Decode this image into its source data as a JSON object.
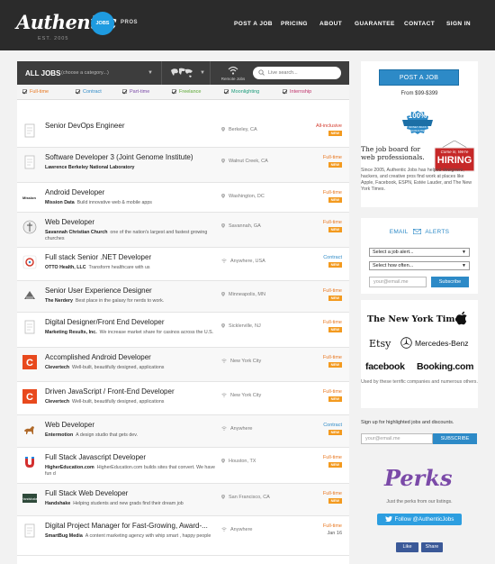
{
  "header": {
    "logo": "Authentic",
    "est": "EST. 2005",
    "badge": "JOBS",
    "pros": "PROS",
    "nav": [
      "POST A JOB",
      "PRICING",
      "ABOUT",
      "GUARANTEE",
      "CONTACT",
      "SIGN IN"
    ]
  },
  "filter": {
    "title": "ALL JOBS",
    "category_placeholder": "(choose a category...)",
    "remote_label": "Remote Jobs",
    "search_placeholder": "Live search..."
  },
  "types": [
    {
      "label": "Full-time",
      "color": "#e8761e"
    },
    {
      "label": "Contract",
      "color": "#2d8ac7"
    },
    {
      "label": "Part-time",
      "color": "#7b4aa8"
    },
    {
      "label": "Freelance",
      "color": "#5aa832"
    },
    {
      "label": "Moonlighting",
      "color": "#1a9b7a"
    },
    {
      "label": "Internship",
      "color": "#c0306a"
    }
  ],
  "jobs": [
    {
      "title": "Senior DevOps Engineer",
      "company": "",
      "desc": "",
      "location": "Berkeley, CA",
      "type": "All-inclusive",
      "type_color": "#d33a2c",
      "badge": "NEW",
      "date": "",
      "logo": "doc"
    },
    {
      "title": "Software Developer 3 (Joint Genome Institute)",
      "company": "Lawrence Berkeley National Laboratory",
      "desc": "",
      "location": "Walnut Creek, CA",
      "type": "Full-time",
      "type_color": "#e8761e",
      "badge": "NEW",
      "date": "",
      "logo": "doc"
    },
    {
      "title": "Android Developer",
      "company": "Mission Data",
      "desc": "Build innovative web & mobile apps",
      "location": "Washington, DC",
      "type": "Full-time",
      "type_color": "#e8761e",
      "badge": "NEW",
      "date": "",
      "logo": "mission"
    },
    {
      "title": "Web Developer",
      "company": "Savannah Christian Church",
      "desc": "one of the nation's largest and fastest growing churches",
      "location": "Savannah, GA",
      "type": "Full-time",
      "type_color": "#e8761e",
      "badge": "NEW",
      "date": "",
      "logo": "church"
    },
    {
      "title": "Full stack Senior .NET Developer",
      "company": "OTTO Health, LLC",
      "desc": "Transform healthcare with us",
      "location": "Anywhere, USA",
      "type": "Contract",
      "type_color": "#2d8ac7",
      "badge": "NEW",
      "date": "",
      "logo": "otto"
    },
    {
      "title": "Senior User Experience Designer",
      "company": "The Nerdery",
      "desc": "Best place in the galaxy for nerds to work.",
      "location": "Minneapolis, MN",
      "type": "Full-time",
      "type_color": "#e8761e",
      "badge": "NEW",
      "date": "",
      "logo": "nerdery"
    },
    {
      "title": "Digital Designer/Front End Developer",
      "company": "Marketing Results, Inc.",
      "desc": "We increase market share for casinos across the U.S.",
      "location": "Sicklerville, NJ",
      "type": "Full-time",
      "type_color": "#e8761e",
      "badge": "NEW",
      "date": "",
      "logo": "doc"
    },
    {
      "title": "Accomplished Android Developer",
      "company": "Clevertech",
      "desc": "Well-built, beautifully designed, applications",
      "location": "New York City",
      "type": "Full-time",
      "type_color": "#e8761e",
      "badge": "NEW",
      "date": "",
      "logo": "clever"
    },
    {
      "title": "Driven JavaScript / Front-End Developer",
      "company": "Clevertech",
      "desc": "Well-built, beautifully designed, applications",
      "location": "New York City",
      "type": "Full-time",
      "type_color": "#e8761e",
      "badge": "NEW",
      "date": "",
      "logo": "clever"
    },
    {
      "title": "Web Developer",
      "company": "Entermotion",
      "desc": "A design studio that gets dev.",
      "location": "Anywhere",
      "type": "Contract",
      "type_color": "#2d8ac7",
      "badge": "NEW",
      "date": "",
      "logo": "horse"
    },
    {
      "title": "Full Stack Javascript Developer",
      "company": "HigherEducation.com",
      "desc": "HigherEducation.com builds sites that convert. We have fun d",
      "location": "Houston, TX",
      "type": "Full-time",
      "type_color": "#e8761e",
      "badge": "NEW",
      "date": "",
      "logo": "higher"
    },
    {
      "title": "Full Stack Web Developer",
      "company": "Handshake",
      "desc": "Helping students and new grads find their dream job",
      "location": "San Francisco, CA",
      "type": "Full-time",
      "type_color": "#e8761e",
      "badge": "NEW",
      "date": "",
      "logo": "handshake"
    },
    {
      "title": "Digital Project Manager for Fast-Growing, Award-...",
      "company": "SmartBug Media",
      "desc": "A content marketing agency with whip smart , happy people",
      "location": "Anywhere",
      "type": "Full-time",
      "type_color": "#e8761e",
      "badge": "",
      "date": "Jan 16",
      "logo": "doc"
    }
  ],
  "sidebar": {
    "post_button": "POST A JOB",
    "price": "From $99-$399",
    "seal_top": "100%",
    "seal_bottom": "MONEY-BACK GUARANTEE",
    "tagline": "The job board for web professionals.",
    "hiring_top": "Come in, We're",
    "hiring_main": "HIRING",
    "since": "Since 2005, Authentic Jobs has helped designers, hackers, and creative pros find work at places like Apple, Facebook, ESPN, Estée Lauder, and The New York Times.",
    "alerts_left": "EMAIL",
    "alerts_right": "ALERTS",
    "select_job": "Select a job alert...",
    "select_often": "Select how often...",
    "email_placeholder": "your@email.me",
    "subscribe": "Subscribe",
    "brands": [
      "The New York Times",
      "Etsy",
      "Mercedes-Benz",
      "facebook",
      "Booking.com"
    ],
    "trusted": "Used by these terrific companies and numerous others.",
    "signup": "Sign up for highlighted jobs and discounts.",
    "email2_placeholder": "your@email.me",
    "subscribe2": "SUBSCRIBE",
    "perks": "Perks",
    "perks_sub": "Just the perks from our listings.",
    "twitter": "Follow @AuthenticJobs",
    "like": "Like",
    "share": "Share"
  }
}
